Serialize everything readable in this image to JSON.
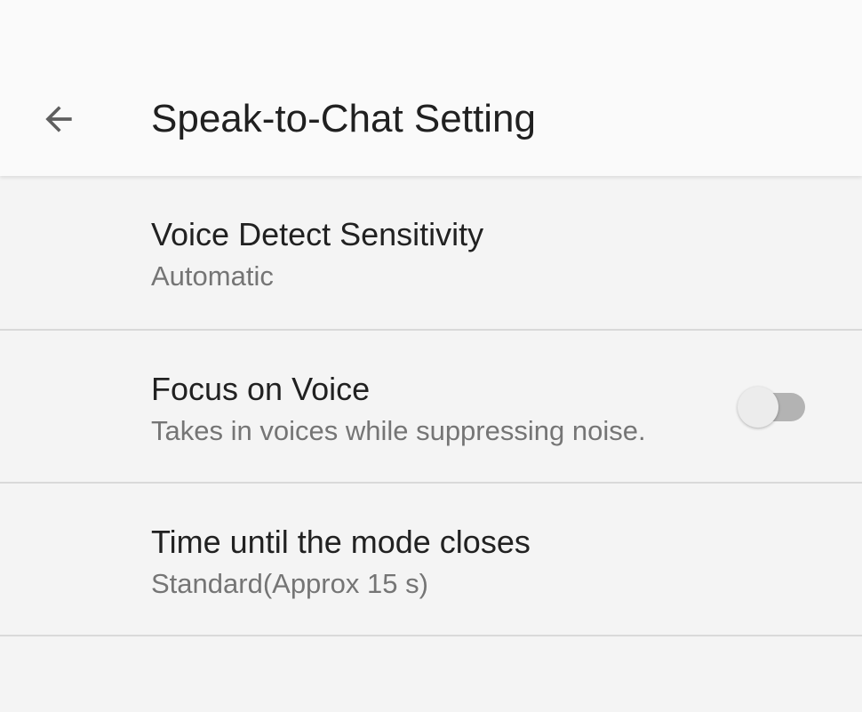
{
  "header": {
    "back_icon": "arrow-left-icon",
    "title": "Speak-to-Chat Setting"
  },
  "settings": [
    {
      "title": "Voice Detect Sensitivity",
      "summary": "Automatic"
    },
    {
      "title": "Focus on Voice",
      "summary": "Takes in voices while suppressing noise.",
      "toggle_on": false
    },
    {
      "title": "Time until the mode closes",
      "summary": "Standard(Approx 15 s)"
    }
  ],
  "colors": {
    "app_bar_bg": "#fafafa",
    "list_bg": "#f4f4f4",
    "divider": "#d9d9d9",
    "title_text": "#212121",
    "summary_text": "#757575",
    "switch_track_off": "#b3b3b3",
    "switch_thumb_off": "#ececec"
  }
}
